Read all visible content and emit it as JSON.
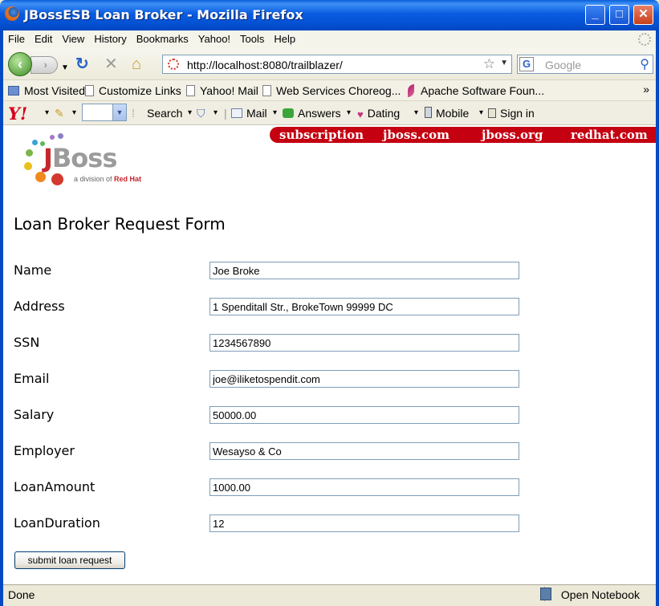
{
  "window": {
    "title": "JBossESB Loan Broker - Mozilla Firefox"
  },
  "menu": [
    "File",
    "Edit",
    "View",
    "History",
    "Bookmarks",
    "Yahoo!",
    "Tools",
    "Help"
  ],
  "nav": {
    "url": "http://localhost:8080/trailblazer/",
    "search_placeholder": "Google"
  },
  "bookmarks": [
    "Most Visited",
    "Customize Links",
    "Yahoo! Mail",
    "Web Services Choreog...",
    "Apache Software Foun..."
  ],
  "yahoo_toolbar": {
    "search": "Search",
    "mail": "Mail",
    "answers": "Answers",
    "dating": "Dating",
    "mobile": "Mobile",
    "sign_in": "Sign in"
  },
  "header_links": [
    "subscription",
    "jboss.com",
    "jboss.org",
    "redhat.com"
  ],
  "logo": {
    "brand_j": "J",
    "brand_rest": "Boss",
    "tagline_prefix": "a division of ",
    "tagline_company": "Red Hat"
  },
  "form": {
    "title": "Loan Broker Request Form",
    "fields": [
      {
        "label": "Name",
        "value": "Joe Broke"
      },
      {
        "label": "Address",
        "value": "1 Spenditall Str., BrokeTown 99999 DC"
      },
      {
        "label": "SSN",
        "value": "1234567890"
      },
      {
        "label": "Email",
        "value": "joe@iliketospendit.com"
      },
      {
        "label": "Salary",
        "value": "50000.00"
      },
      {
        "label": "Employer",
        "value": "Wesayso & Co"
      },
      {
        "label": "LoanAmount",
        "value": "1000.00"
      },
      {
        "label": "LoanDuration",
        "value": "12"
      }
    ],
    "submit_label": "submit loan request"
  },
  "status": {
    "text": "Done",
    "notebook": "Open Notebook"
  },
  "colors": {
    "header_red": "#c40011",
    "brand_red": "#c4282d",
    "titlebar_blue": "#0552d4"
  }
}
